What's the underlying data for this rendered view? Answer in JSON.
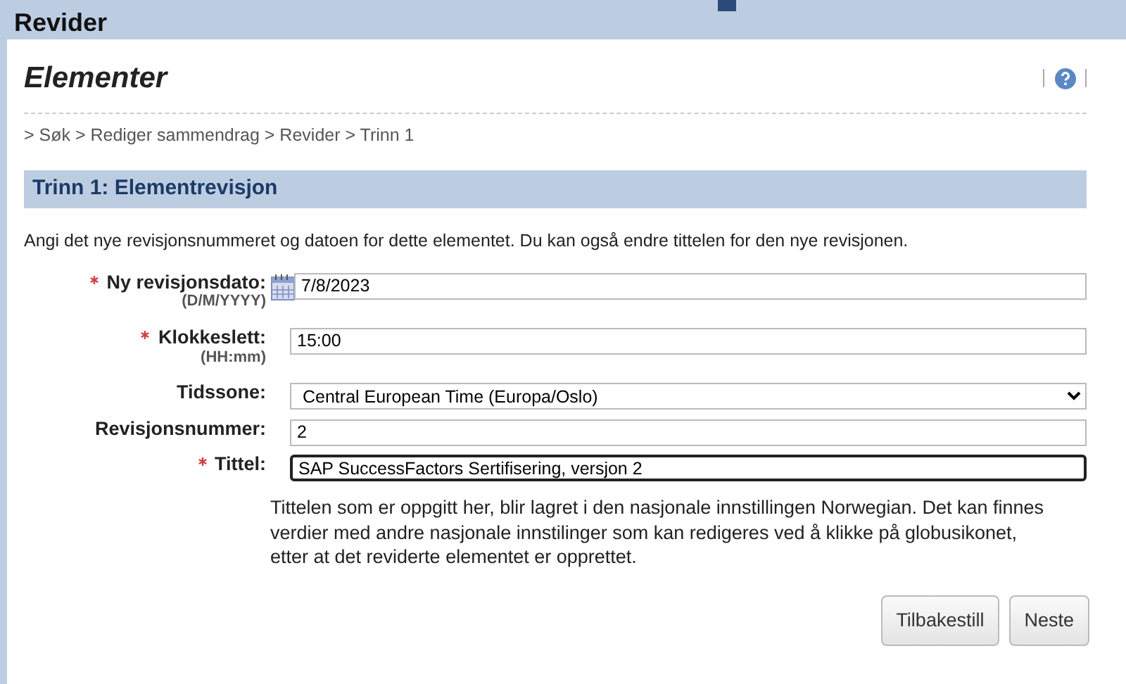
{
  "window": {
    "title": "Revider"
  },
  "page": {
    "title": "Elementer",
    "breadcrumb": "> Søk > Rediger sammendrag > Revider > Trinn 1"
  },
  "section": {
    "title": "Trinn 1: Elementrevisjon",
    "intro": "Angi det nye revisjonsnummeret og datoen for dette elementet. Du kan også endre tittelen for den nye revisjonen."
  },
  "fields": [
    {
      "kind": "date",
      "label": "Ny revisjonsdato:",
      "hint": "(D/M/YYYY)",
      "required": true,
      "value": "7/8/2023",
      "focused": false
    },
    {
      "kind": "text",
      "label": "Klokkeslett:",
      "hint": "(HH:mm)",
      "required": true,
      "value": "15:00",
      "focused": false
    },
    {
      "kind": "select",
      "label": "Tidssone:",
      "required": false,
      "value": "Central European Time (Europa/Oslo)",
      "focused": false
    },
    {
      "kind": "text",
      "label": "Revisjonsnummer:",
      "required": false,
      "value": "2",
      "focused": false
    },
    {
      "kind": "text",
      "label": "Tittel:",
      "required": true,
      "value": "SAP SuccessFactors Sertifisering, versjon 2",
      "focused": true
    }
  ],
  "note": "Tittelen som er oppgitt her, blir lagret i den nasjonale innstillingen Norwegian. Det kan finnes verdier med andre nasjonale innstilinger som kan redigeres ved å klikke på globusikonet, etter at det reviderte elementet er opprettet.",
  "buttons": [
    "Tilbakestill",
    "Neste"
  ]
}
